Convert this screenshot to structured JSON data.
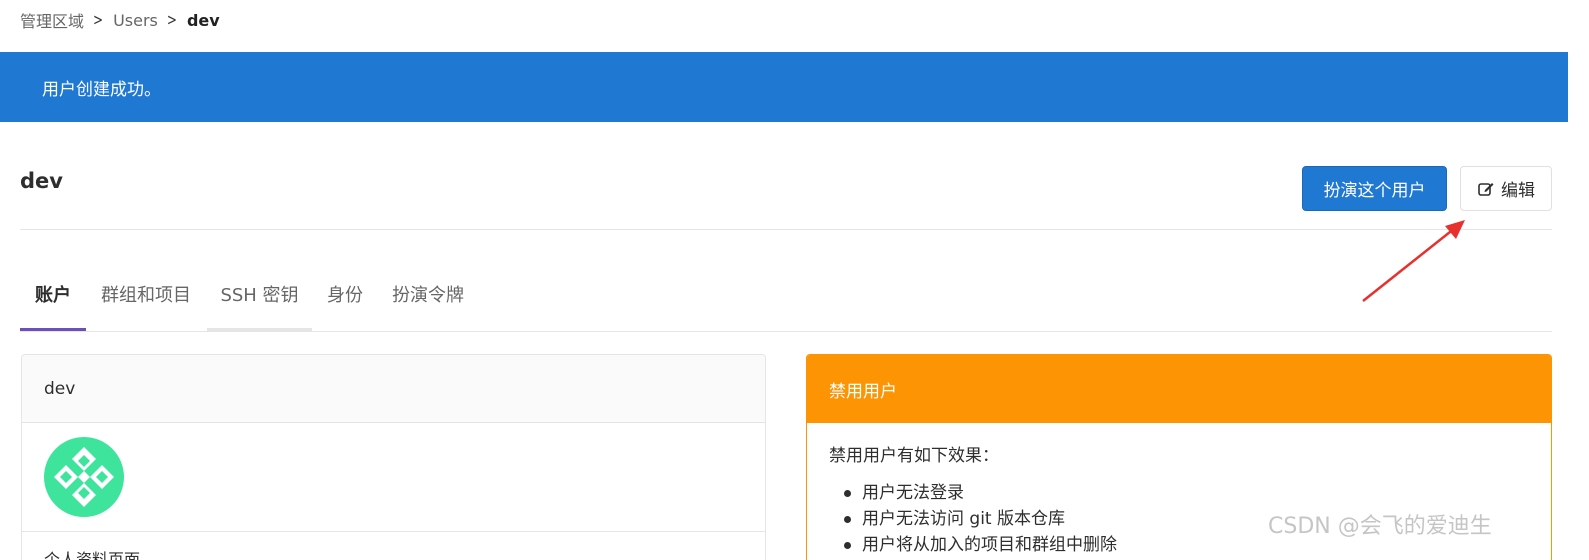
{
  "breadcrumb": {
    "items": [
      "管理区域",
      "Users"
    ],
    "current": "dev"
  },
  "flash": {
    "message": "用户创建成功。"
  },
  "page": {
    "title": "dev"
  },
  "buttons": {
    "impersonate": "扮演这个用户",
    "edit": "编辑"
  },
  "tabs": [
    {
      "label": "账户",
      "active": true
    },
    {
      "label": "群组和项目",
      "active": false
    },
    {
      "label": "SSH 密钥",
      "active": false
    },
    {
      "label": "身份",
      "active": false
    },
    {
      "label": "扮演令牌",
      "active": false
    }
  ],
  "profile_card": {
    "header": "dev",
    "next_row": "个人资料页面"
  },
  "block_card": {
    "header": "禁用用户",
    "intro": "禁用用户有如下效果：",
    "effects": [
      "用户无法登录",
      "用户无法访问 git 版本仓库",
      "用户将从加入的项目和群组中删除"
    ]
  },
  "watermark": "CSDN @会飞的爱迪生",
  "colors": {
    "primary": "#1f78d1",
    "warning": "#fc9403",
    "active_tab": "#6b4fbb",
    "avatar": "#3ee39c",
    "annotation_arrow": "#e8312f"
  }
}
